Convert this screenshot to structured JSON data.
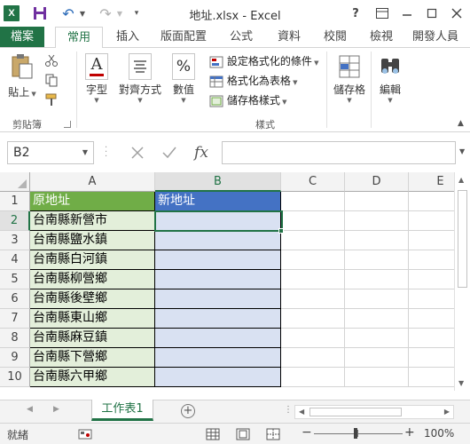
{
  "window": {
    "title": "地址.xlsx - Excel",
    "help": "?",
    "ribbon_display_icon": "ribbon-display-icon",
    "minimize_icon": "minimize-icon",
    "maximize_icon": "maximize-icon",
    "close_icon": "close-icon"
  },
  "qat": {
    "app_icon_label": "X",
    "save_icon": "save-icon",
    "undo_icon": "undo-icon",
    "redo_icon": "redo-icon"
  },
  "tabs": [
    {
      "label": "檔案"
    },
    {
      "label": "常用",
      "active": true
    },
    {
      "label": "插入"
    },
    {
      "label": "版面配置"
    },
    {
      "label": "公式"
    },
    {
      "label": "資料"
    },
    {
      "label": "校閱"
    },
    {
      "label": "檢視"
    },
    {
      "label": "開發人員"
    }
  ],
  "ribbon": {
    "paste_label": "貼上",
    "clipboard_group": "剪貼簿",
    "font_label": "字型",
    "alignment_label": "對齊方式",
    "number_label": "數值",
    "number_symbol": "%",
    "conditional_formatting": "設定格式化的條件",
    "format_as_table": "格式化為表格",
    "cell_styles": "儲存格樣式",
    "styles_group": "樣式",
    "cells_label": "儲存格",
    "editing_label": "編輯"
  },
  "formula_bar": {
    "name_box": "B2",
    "fx_label": "fx",
    "formula_value": ""
  },
  "columns": [
    "A",
    "B",
    "C",
    "D",
    "E"
  ],
  "selected_column": "B",
  "rows": [
    {
      "num": "1",
      "a": "原地址",
      "b": "新地址"
    },
    {
      "num": "2",
      "a": "台南縣新營市",
      "b": ""
    },
    {
      "num": "3",
      "a": "台南縣鹽水鎮",
      "b": ""
    },
    {
      "num": "4",
      "a": "台南縣白河鎮",
      "b": ""
    },
    {
      "num": "5",
      "a": "台南縣柳營鄉",
      "b": ""
    },
    {
      "num": "6",
      "a": "台南縣後壁鄉",
      "b": ""
    },
    {
      "num": "7",
      "a": "台南縣東山鄉",
      "b": ""
    },
    {
      "num": "8",
      "a": "台南縣麻豆鎮",
      "b": ""
    },
    {
      "num": "9",
      "a": "台南縣下營鄉",
      "b": ""
    },
    {
      "num": "10",
      "a": "台南縣六甲鄉",
      "b": ""
    }
  ],
  "selected_row": "2",
  "colors": {
    "excel_green": "#217346",
    "header_a": "#70ad47",
    "header_b": "#4472c4",
    "band_a": "#e3efda",
    "band_b": "#d9e1f2"
  },
  "sheets": [
    {
      "label": "工作表1",
      "active": true
    }
  ],
  "status": {
    "ready": "就緒",
    "zoom_level": "100%",
    "view_icons": [
      "normal-view-icon",
      "page-layout-icon",
      "page-break-icon"
    ]
  }
}
